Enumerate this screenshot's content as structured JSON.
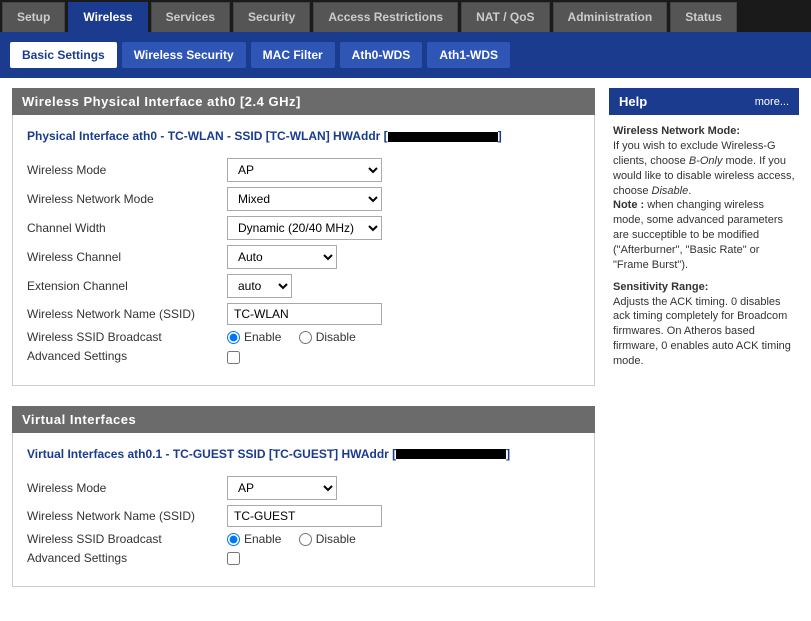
{
  "tabs": [
    "Setup",
    "Wireless",
    "Services",
    "Security",
    "Access Restrictions",
    "NAT / QoS",
    "Administration",
    "Status"
  ],
  "tabs_active": 1,
  "subtabs": [
    "Basic Settings",
    "Wireless Security",
    "MAC Filter",
    "Ath0-WDS",
    "Ath1-WDS"
  ],
  "subtabs_active": 0,
  "section1_title": "Wireless Physical Interface ath0 [2.4 GHz]",
  "phys": {
    "legend_pre": "Physical Interface ath0 - TC-WLAN - SSID [TC-WLAN] HWAddr [",
    "legend_post": "]",
    "labels": {
      "mode": "Wireless Mode",
      "netmode": "Wireless Network Mode",
      "chwidth": "Channel Width",
      "channel": "Wireless Channel",
      "extch": "Extension Channel",
      "ssid": "Wireless Network Name (SSID)",
      "broadcast": "Wireless SSID Broadcast",
      "advanced": "Advanced Settings",
      "enable": "Enable",
      "disable": "Disable"
    },
    "values": {
      "mode": "AP",
      "netmode": "Mixed",
      "chwidth": "Dynamic (20/40 MHz)",
      "channel": "Auto",
      "extch": "auto",
      "ssid": "TC-WLAN"
    }
  },
  "section2_title": "Virtual Interfaces",
  "vif": {
    "legend_pre": "Virtual Interfaces ath0.1 - TC-GUEST SSID [TC-GUEST] HWAddr [",
    "legend_post": "]",
    "labels": {
      "mode": "Wireless Mode",
      "ssid": "Wireless Network Name (SSID)",
      "broadcast": "Wireless SSID Broadcast",
      "advanced": "Advanced Settings",
      "enable": "Enable",
      "disable": "Disable"
    },
    "values": {
      "mode": "AP",
      "ssid": "TC-GUEST"
    }
  },
  "help": {
    "title": "Help",
    "more": "more...",
    "h1": "Wireless Network Mode:",
    "p1a": "If you wish to exclude Wireless-G clients, choose ",
    "p1b": "B-Only",
    "p1c": " mode. If you would like to disable wireless access, choose ",
    "p1d": "Disable",
    "p1e": ".",
    "note_label": "Note :",
    "note_text": " when changing wireless mode, some advanced parameters are succeptible to be modified (\"Afterburner\", \"Basic Rate\" or \"Frame Burst\").",
    "h2": "Sensitivity Range:",
    "p2": "Adjusts the ACK timing. 0 disables ack timing completely for Broadcom firmwares. On Atheros based firmware, 0 enables auto ACK timing mode."
  }
}
